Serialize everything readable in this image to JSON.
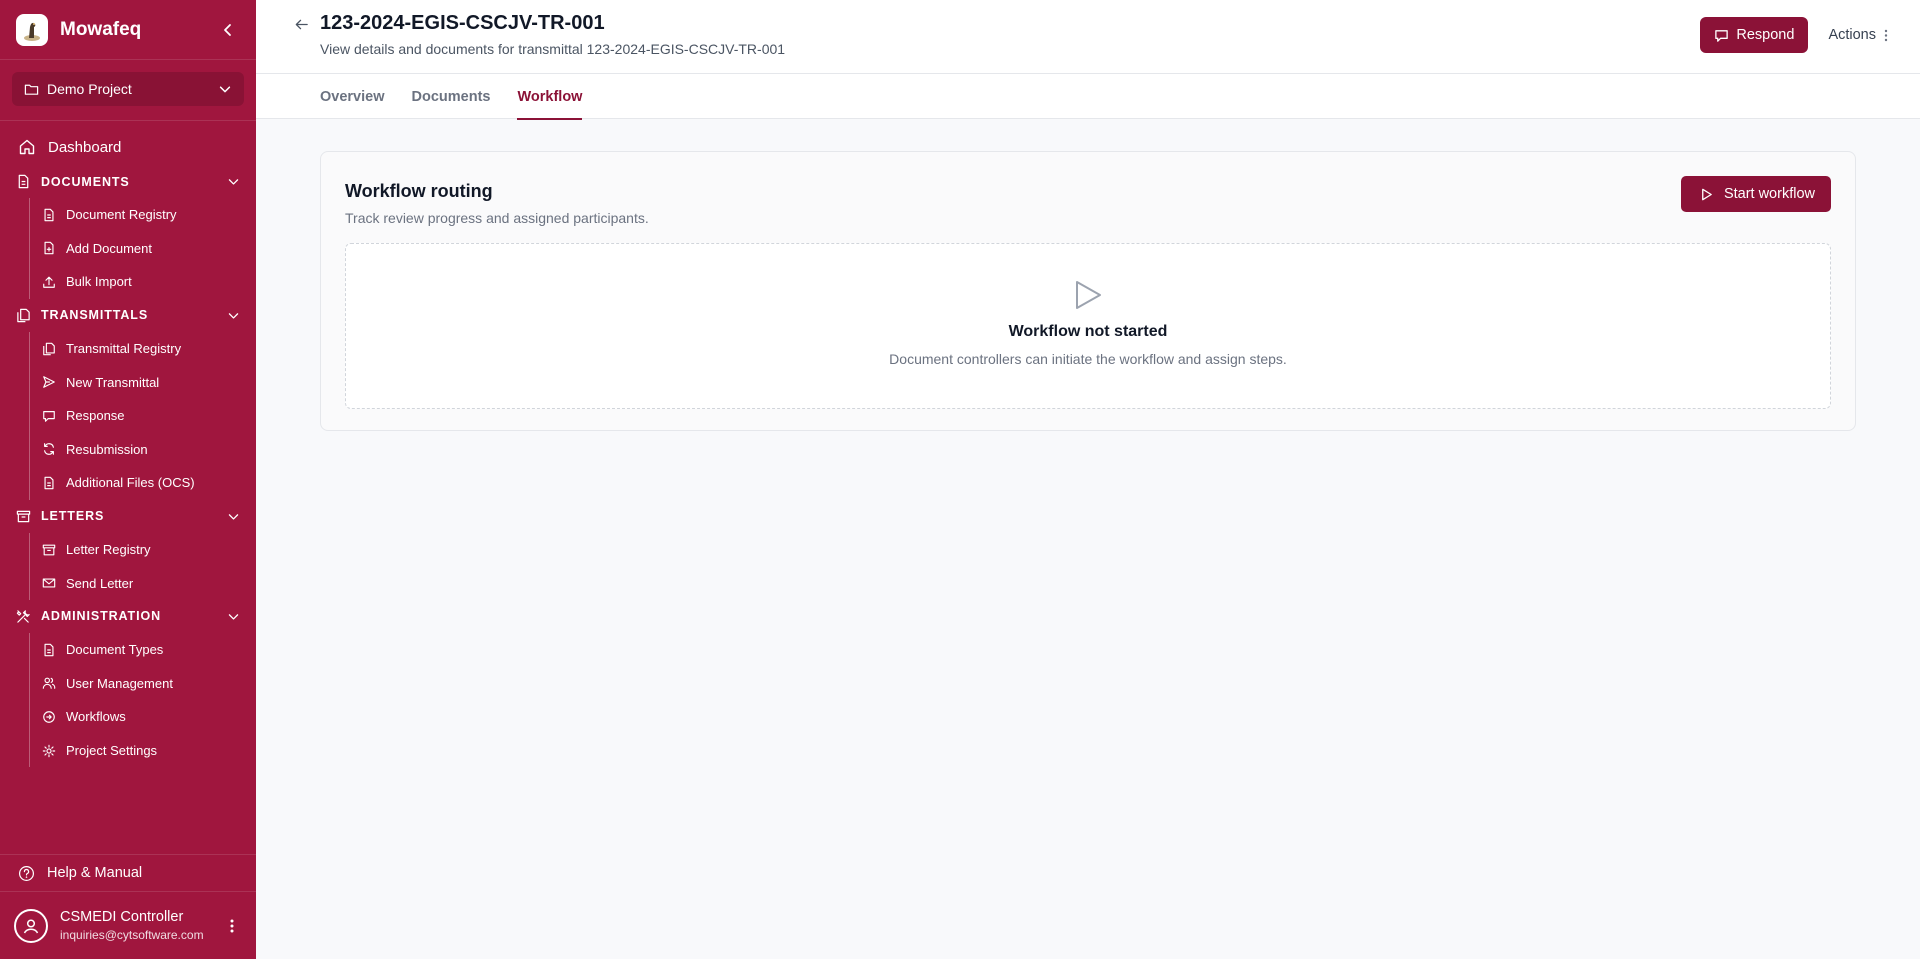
{
  "app": {
    "name": "Mowafeq"
  },
  "project": {
    "selected": "Demo Project"
  },
  "sidebar": {
    "dashboard": "Dashboard",
    "sections": [
      {
        "title": "DOCUMENTS",
        "items": [
          "Document Registry",
          "Add Document",
          "Bulk Import"
        ]
      },
      {
        "title": "TRANSMITTALS",
        "items": [
          "Transmittal Registry",
          "New Transmittal",
          "Response",
          "Resubmission",
          "Additional Files (OCS)"
        ]
      },
      {
        "title": "LETTERS",
        "items": [
          "Letter Registry",
          "Send Letter"
        ]
      },
      {
        "title": "ADMINISTRATION",
        "items": [
          "Document Types",
          "User Management",
          "Workflows",
          "Project Settings"
        ]
      }
    ],
    "help": "Help & Manual",
    "user": {
      "name": "CSMEDI Controller",
      "email": "inquiries@cytsoftware.com"
    }
  },
  "header": {
    "title": "123-2024-EGIS-CSCJV-TR-001",
    "subtitle": "View details and documents for transmittal 123-2024-EGIS-CSCJV-TR-001",
    "respond_label": "Respond",
    "actions_label": "Actions"
  },
  "tabs": [
    {
      "label": "Overview",
      "active": false
    },
    {
      "label": "Documents",
      "active": false
    },
    {
      "label": "Workflow",
      "active": true
    }
  ],
  "workflow": {
    "title": "Workflow routing",
    "subtitle": "Track review progress and assigned participants.",
    "start_label": "Start workflow",
    "empty_title": "Workflow not started",
    "empty_subtitle": "Document controllers can initiate the workflow and assign steps."
  },
  "colors": {
    "sidebar": "#a0163e",
    "accent": "#8b1237",
    "background": "#f8f9fb"
  }
}
